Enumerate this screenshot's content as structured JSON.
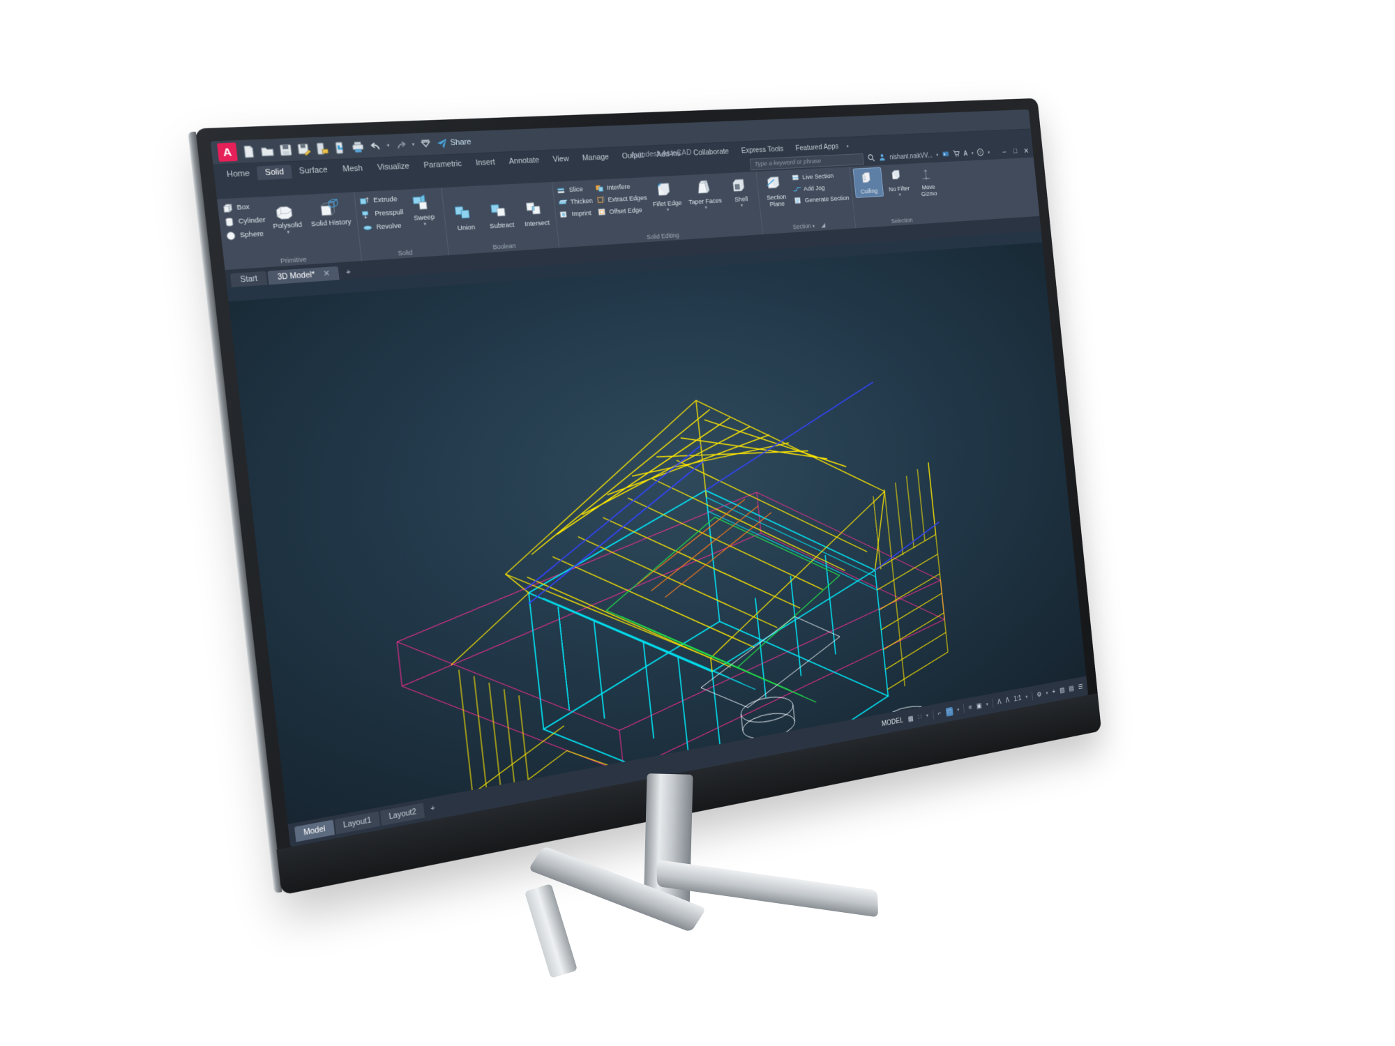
{
  "app": {
    "title": "Autodesk AutoCAD",
    "logo_letter": "A",
    "brand_color": "#e62058"
  },
  "quick_access": {
    "items": [
      {
        "name": "new-file-icon",
        "label": "New"
      },
      {
        "name": "open-file-icon",
        "label": "Open"
      },
      {
        "name": "save-icon",
        "label": "Save"
      },
      {
        "name": "save-as-icon",
        "label": "Save As"
      },
      {
        "name": "save-to-web-icon",
        "label": "Save to Web & Mobile"
      },
      {
        "name": "open-from-web-icon",
        "label": "Open from Web & Mobile"
      },
      {
        "name": "plot-icon",
        "label": "Plot"
      },
      {
        "name": "undo-icon",
        "label": "Undo"
      },
      {
        "name": "redo-icon",
        "label": "Redo"
      },
      {
        "name": "customize-qat-icon",
        "label": "Customize Quick Access Toolbar"
      }
    ],
    "share_label": "Share"
  },
  "ribbon_tabs": [
    {
      "label": "Home",
      "active": false
    },
    {
      "label": "Solid",
      "active": true
    },
    {
      "label": "Surface",
      "active": false
    },
    {
      "label": "Mesh",
      "active": false
    },
    {
      "label": "Visualize",
      "active": false
    },
    {
      "label": "Parametric",
      "active": false
    },
    {
      "label": "Insert",
      "active": false
    },
    {
      "label": "Annotate",
      "active": false
    },
    {
      "label": "View",
      "active": false
    },
    {
      "label": "Manage",
      "active": false
    },
    {
      "label": "Output",
      "active": false
    },
    {
      "label": "Add-ins",
      "active": false
    },
    {
      "label": "Collaborate",
      "active": false
    },
    {
      "label": "Express Tools",
      "active": false
    },
    {
      "label": "Featured Apps",
      "active": false
    }
  ],
  "search": {
    "placeholder": "Type a keyword or phrase",
    "expand_arrow": "▸"
  },
  "account": {
    "user": "nishant.naikVV...",
    "dropdown_caret": "▾",
    "icons": [
      {
        "name": "search-icon",
        "glyph": "⌕"
      },
      {
        "name": "user-account-icon",
        "glyph": "👤"
      },
      {
        "name": "autodesk-cloud-icon",
        "glyph": "■"
      },
      {
        "name": "cart-icon",
        "glyph": "🛒"
      },
      {
        "name": "notification-icon",
        "glyph": "A"
      },
      {
        "name": "help-icon",
        "glyph": "?"
      }
    ],
    "window_controls": [
      {
        "name": "minimize-button",
        "glyph": "–"
      },
      {
        "name": "maximize-button",
        "glyph": "□"
      },
      {
        "name": "close-button",
        "glyph": "✕"
      }
    ]
  },
  "ribbon_panels": [
    {
      "title": "Primitive",
      "small_buttons": [
        {
          "label": "Box",
          "icon": "box-icon"
        },
        {
          "label": "Cylinder",
          "icon": "cylinder-icon"
        },
        {
          "label": "Sphere",
          "icon": "sphere-icon"
        }
      ],
      "big_buttons": [
        {
          "label": "Polysolid",
          "icon": "polysolid-icon",
          "has_caret": true
        },
        {
          "label": "Solid History",
          "icon": "solid-history-icon",
          "has_caret": false
        }
      ]
    },
    {
      "title": "Solid",
      "small_buttons": [
        {
          "label": "Extrude",
          "icon": "extrude-icon"
        },
        {
          "label": "Presspull",
          "icon": "presspull-icon"
        },
        {
          "label": "Revolve",
          "icon": "revolve-icon"
        }
      ],
      "big_buttons": [
        {
          "label": "Sweep",
          "icon": "sweep-icon",
          "has_caret": true
        }
      ]
    },
    {
      "title": "Boolean",
      "small_buttons": [],
      "big_buttons": [
        {
          "label": "Union",
          "icon": "union-icon",
          "has_caret": false
        },
        {
          "label": "Subtract",
          "icon": "subtract-icon",
          "has_caret": false
        },
        {
          "label": "Intersect",
          "icon": "intersect-icon",
          "has_caret": false
        }
      ]
    },
    {
      "title": "Solid Editing",
      "small_buttons": [
        {
          "label": "Slice",
          "icon": "slice-icon"
        },
        {
          "label": "Thicken",
          "icon": "thicken-icon"
        },
        {
          "label": "Imprint",
          "icon": "imprint-icon"
        },
        {
          "label": "Interfere",
          "icon": "interfere-icon"
        },
        {
          "label": "Extract Edges",
          "icon": "extract-edges-icon"
        },
        {
          "label": "Offset Edge",
          "icon": "offset-edge-icon"
        }
      ],
      "big_buttons": [
        {
          "label": "Fillet Edge",
          "icon": "fillet-edge-icon",
          "has_caret": true
        },
        {
          "label": "Taper Faces",
          "icon": "taper-faces-icon",
          "has_caret": true
        },
        {
          "label": "Shell",
          "icon": "shell-icon",
          "has_caret": true
        }
      ]
    },
    {
      "title": "Section",
      "small_buttons": [
        {
          "label": "Live Section",
          "icon": "live-section-icon"
        },
        {
          "label": "Add Jog",
          "icon": "add-jog-icon"
        },
        {
          "label": "Generate Section",
          "icon": "generate-section-icon"
        }
      ],
      "big_buttons": [
        {
          "label": "Section Plane",
          "icon": "section-plane-icon",
          "has_caret": false
        }
      ],
      "has_dialog_launcher": true
    },
    {
      "title": "Selection",
      "small_buttons": [],
      "big_buttons": [
        {
          "label": "Culling",
          "icon": "culling-icon",
          "has_caret": false,
          "selected": true
        },
        {
          "label": "No Filter",
          "icon": "no-filter-icon",
          "has_caret": true
        },
        {
          "label": "Move Gizmo",
          "icon": "move-gizmo-icon",
          "has_caret": true
        }
      ]
    }
  ],
  "file_tabs": [
    {
      "label": "Start",
      "active": false,
      "closable": false
    },
    {
      "label": "3D Model*",
      "active": true,
      "closable": true
    }
  ],
  "file_tab_add": "+",
  "layout_tabs": [
    {
      "label": "Model",
      "active": true
    },
    {
      "label": "Layout1",
      "active": false
    },
    {
      "label": "Layout2",
      "active": false
    }
  ],
  "layout_tab_add": "+",
  "status_bar": {
    "model_label": "MODEL",
    "scale": "1:1",
    "items": [
      {
        "name": "grid-display-toggle",
        "glyph": "▦"
      },
      {
        "name": "snap-mode-toggle",
        "glyph": "∷"
      },
      {
        "name": "ortho-mode-toggle",
        "glyph": "⌐"
      },
      {
        "name": "polar-tracking-toggle",
        "glyph": "∠"
      },
      {
        "name": "object-snap-toggle",
        "glyph": "□"
      },
      {
        "name": "osnap-tracking-toggle",
        "glyph": "∠"
      },
      {
        "name": "lineweight-toggle",
        "glyph": "≡"
      },
      {
        "name": "transparency-toggle",
        "glyph": "▣"
      },
      {
        "name": "annotation-scale-visibility",
        "glyph": "Λ"
      },
      {
        "name": "auto-scale-toggle",
        "glyph": "Λ"
      },
      {
        "name": "annotation-scale-label",
        "glyph": "1:1"
      },
      {
        "name": "workspace-switching-icon",
        "glyph": "⚙"
      },
      {
        "name": "hardware-acceleration-icon",
        "glyph": "+"
      },
      {
        "name": "isolate-objects-icon",
        "glyph": "▨"
      },
      {
        "name": "clean-screen-icon",
        "glyph": "▤"
      },
      {
        "name": "customization-menu-icon",
        "glyph": "☰"
      }
    ]
  },
  "drawing": {
    "title": "3D Model",
    "description": "Wireframe 3D model of a house/cabin structure with timber framing, shown in isometric view",
    "colors": {
      "cyan": "#00e5f5",
      "yellow": "#ffe800",
      "green": "#22e04a",
      "magenta": "#ff2d95",
      "orange": "#ff7a1a",
      "blue": "#3344ff",
      "white": "#e8eef3"
    }
  }
}
